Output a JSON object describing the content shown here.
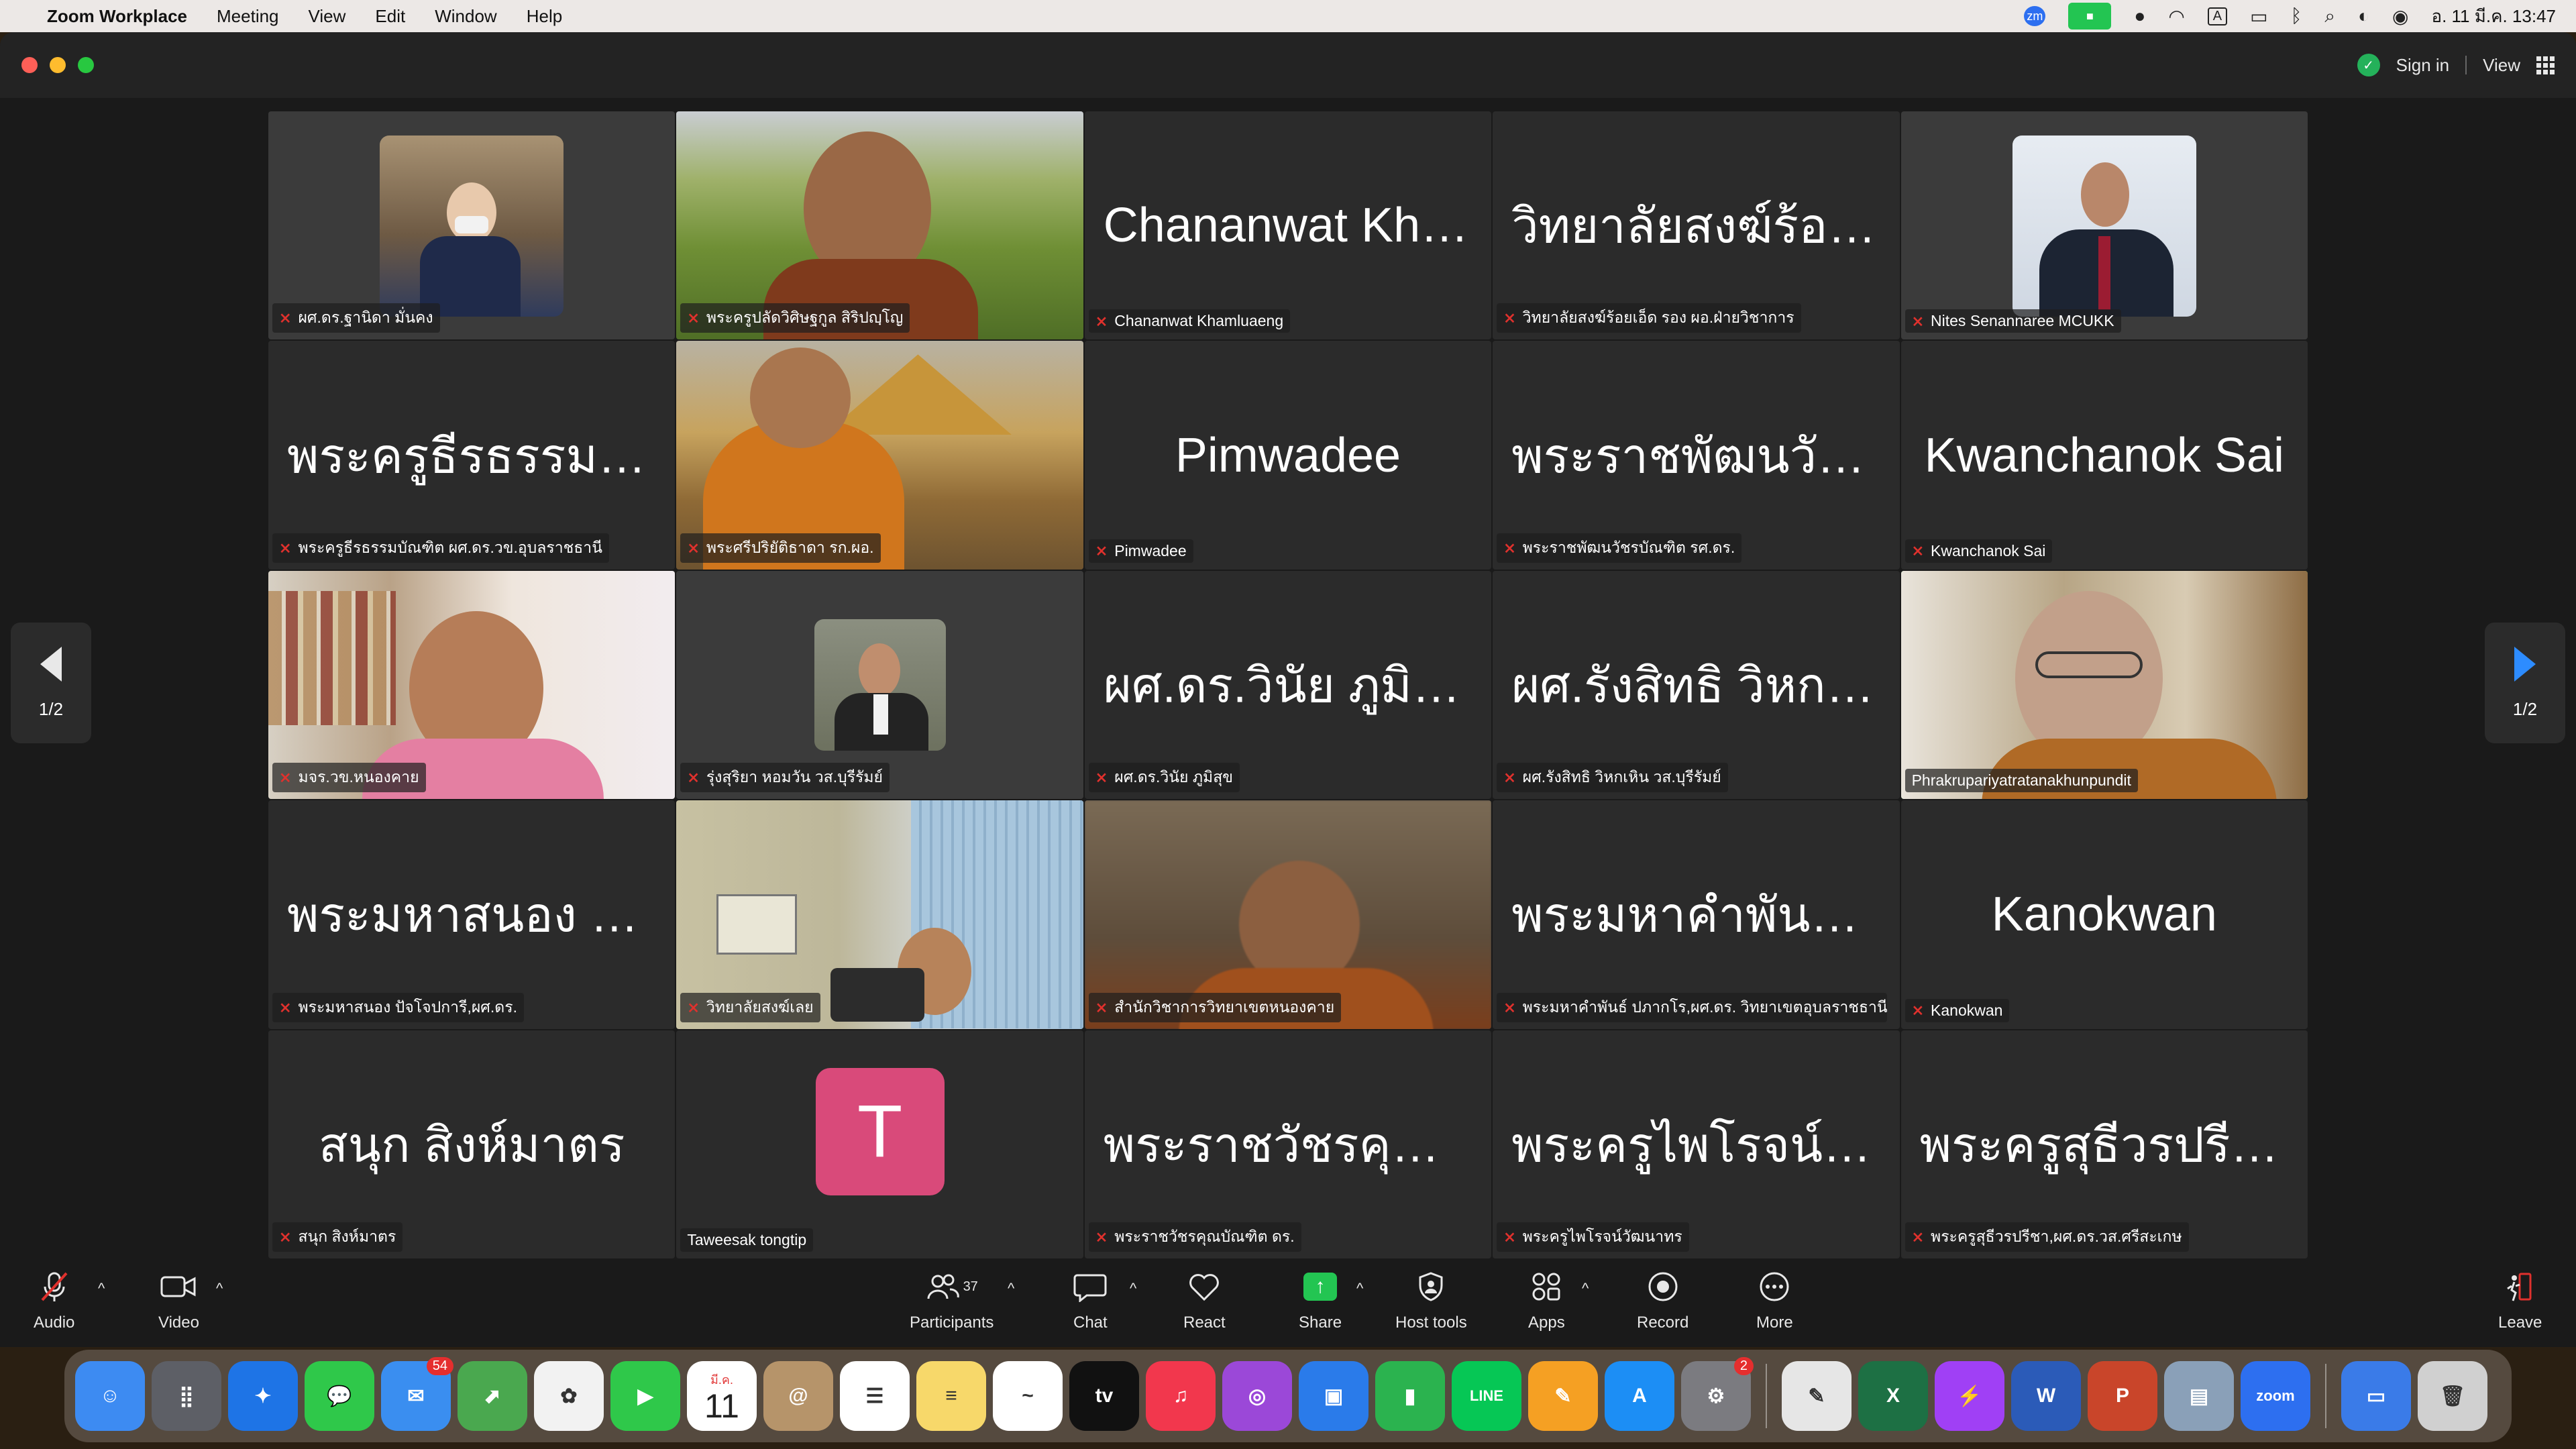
{
  "menubar": {
    "app": "Zoom Workplace",
    "items": [
      "Meeting",
      "View",
      "Edit",
      "Window",
      "Help"
    ],
    "clock": "อ. 11 มี.ค.  13:47"
  },
  "titlebar": {
    "sign_in": "Sign in",
    "view": "View"
  },
  "pager": {
    "left": "1/2",
    "right": "1/2"
  },
  "tiles": [
    {
      "big": "",
      "label": "ผศ.ดร.ฐานิดา มั่นคง",
      "muted": true,
      "video": "thumb-woman"
    },
    {
      "big": "",
      "label": "พระครูปลัดวิศิษฐกูล สิริปญฺโญ",
      "muted": true,
      "video": "full-monk-field"
    },
    {
      "big": "Chananwat Kha...",
      "label": "Chananwat Khamluaeng",
      "muted": true,
      "video": ""
    },
    {
      "big": "วิทยาลัยสงฆ์ร้อยเ...",
      "label": "วิทยาลัยสงฆ์ร้อยเอ็ด รอง ผอ.ฝ่ายวิชาการ",
      "muted": true,
      "video": ""
    },
    {
      "big": "",
      "label": "Nites Senannaree MCUKK",
      "muted": true,
      "video": "thumb-man-tie"
    },
    {
      "big": "พระครูธีรธรรมบั...",
      "label": "พระครูธีรธรรมบัณฑิต ผศ.ดร.วข.อุบลราชธานี",
      "muted": true,
      "video": ""
    },
    {
      "big": "",
      "label": "พระศรีปริยัติธาดา รก.ผอ.",
      "muted": true,
      "video": "full-monk-temple"
    },
    {
      "big": "Pimwadee",
      "label": "Pimwadee",
      "muted": true,
      "video": ""
    },
    {
      "big": "พระราชพัฒนวัชร...",
      "label": "พระราชพัฒนวัชรบัณฑิต รศ.ดร.",
      "muted": true,
      "video": ""
    },
    {
      "big": "Kwanchanok Sai",
      "label": "Kwanchanok Sai",
      "muted": true,
      "video": ""
    },
    {
      "big": "",
      "label": "มจร.วข.หนองคาย",
      "muted": true,
      "video": "full-man-pink"
    },
    {
      "big": "",
      "label": "รุ่งสุริยา หอมวัน วส.บุรีรัมย์",
      "muted": true,
      "video": "thumb-man-suit"
    },
    {
      "big": "ผศ.ดร.วินัย ภูมิสุข",
      "label": "ผศ.ดร.วินัย ภูมิสุข",
      "muted": true,
      "video": ""
    },
    {
      "big": "ผศ.รังสิทธิ วิหกเ...",
      "label": "ผศ.รังสิทธิ วิหกเหิน วส.บุรีรัมย์",
      "muted": true,
      "video": ""
    },
    {
      "big": "",
      "label": "Phrakrupariyatratanakhunpundit",
      "muted": false,
      "video": "full-monk-glasses",
      "active": true
    },
    {
      "big": "พระมหาสนอง ปัจ...",
      "label": "พระมหาสนอง ปัจโจปการี,ผศ.ดร.",
      "muted": true,
      "video": ""
    },
    {
      "big": "",
      "label": "วิทยาลัยสงฆ์เลย",
      "muted": true,
      "video": "full-office"
    },
    {
      "big": "",
      "label": "สำนักวิชาการวิทยาเขตหนองคาย",
      "muted": true,
      "video": "full-monk-blur"
    },
    {
      "big": "พระมหาคำพันธ์ ป...",
      "label": "พระมหาคำพันธ์ ปภากโร,ผศ.ดร. วิทยาเขตอุบลราชธานี",
      "muted": true,
      "video": ""
    },
    {
      "big": "Kanokwan",
      "label": "Kanokwan",
      "muted": true,
      "video": ""
    },
    {
      "big": "สนุก สิงห์มาตร",
      "label": "สนุก สิงห์มาตร",
      "muted": true,
      "video": ""
    },
    {
      "big": "",
      "label": "Taweesak tongtip",
      "muted": false,
      "video": "avatar",
      "avatar": "T"
    },
    {
      "big": "พระราชวัชรคุณบั...",
      "label": "พระราชวัชรคุณบัณฑิต ดร.",
      "muted": true,
      "video": ""
    },
    {
      "big": "พระครูไพโรจน์วั...",
      "label": "พระครูไพโรจน์วัฒนาทร",
      "muted": true,
      "video": ""
    },
    {
      "big": "พระครูสุธีวรปรีชา...",
      "label": "พระครูสุธีวรปรีชา,ผศ.ดร.วส.ศรีสะเกษ",
      "muted": true,
      "video": ""
    }
  ],
  "toolbar": {
    "audio": "Audio",
    "video": "Video",
    "participants": "Participants",
    "participants_count": "37",
    "chat": "Chat",
    "react": "React",
    "share": "Share",
    "host_tools": "Host tools",
    "apps": "Apps",
    "record": "Record",
    "more": "More",
    "leave": "Leave"
  },
  "dock": {
    "mail_badge": "54",
    "calendar_month": "มี.ค.",
    "calendar_day": "11",
    "settings_badge": "2",
    "apps": [
      "Finder",
      "Launchpad",
      "Safari",
      "Messages",
      "Mail",
      "Maps",
      "Photos",
      "FaceTime",
      "Calendar",
      "Contacts",
      "Reminders",
      "Notes",
      "Freeform",
      "TV",
      "Music",
      "Podcasts",
      "Keynote",
      "Numbers",
      "LINE",
      "Pages",
      "App Store",
      "System Settings",
      "Script Editor",
      "Excel",
      "Messenger",
      "Word",
      "PowerPoint",
      "Preview",
      "Zoom",
      "Downloads",
      "Trash"
    ]
  },
  "colors": {
    "accent": "#2d8cff",
    "active_border": "#4ec95a",
    "muted_mic": "#e0312d",
    "share_green": "#23c552"
  }
}
